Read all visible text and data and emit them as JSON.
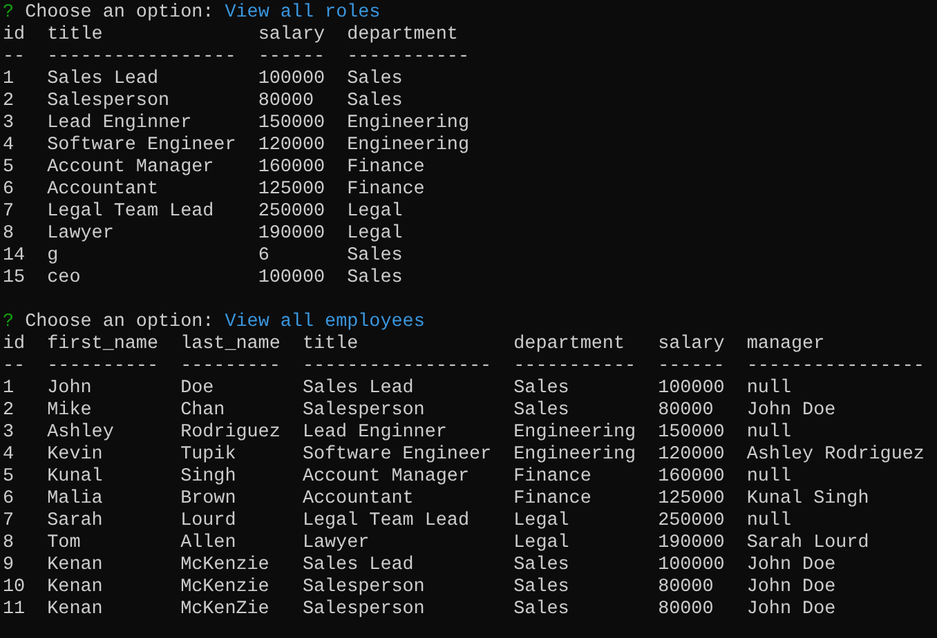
{
  "sections": [
    {
      "prompt": {
        "mark": "?",
        "label": "Choose an option:",
        "answer": "View all roles"
      },
      "columns": [
        "id",
        "title",
        "salary",
        "department"
      ],
      "dashes": [
        "--",
        "-----------------",
        "------",
        "-----------"
      ],
      "rows": [
        [
          "1",
          "Sales Lead",
          "100000",
          "Sales"
        ],
        [
          "2",
          "Salesperson",
          "80000",
          "Sales"
        ],
        [
          "3",
          "Lead Enginner",
          "150000",
          "Engineering"
        ],
        [
          "4",
          "Software Engineer",
          "120000",
          "Engineering"
        ],
        [
          "5",
          "Account Manager",
          "160000",
          "Finance"
        ],
        [
          "6",
          "Accountant",
          "125000",
          "Finance"
        ],
        [
          "7",
          "Legal Team Lead",
          "250000",
          "Legal"
        ],
        [
          "8",
          "Lawyer",
          "190000",
          "Legal"
        ],
        [
          "14",
          "g",
          "6",
          "Sales"
        ],
        [
          "15",
          "ceo",
          "100000",
          "Sales"
        ]
      ]
    },
    {
      "prompt": {
        "mark": "?",
        "label": "Choose an option:",
        "answer": "View all employees"
      },
      "columns": [
        "id",
        "first_name",
        "last_name",
        "title",
        "department",
        "salary",
        "manager"
      ],
      "dashes": [
        "--",
        "----------",
        "---------",
        "-----------------",
        "-----------",
        "------",
        "----------------"
      ],
      "rows": [
        [
          "1",
          "John",
          "Doe",
          "Sales Lead",
          "Sales",
          "100000",
          "null"
        ],
        [
          "2",
          "Mike",
          "Chan",
          "Salesperson",
          "Sales",
          "80000",
          "John Doe"
        ],
        [
          "3",
          "Ashley",
          "Rodriguez",
          "Lead Enginner",
          "Engineering",
          "150000",
          "null"
        ],
        [
          "4",
          "Kevin",
          "Tupik",
          "Software Engineer",
          "Engineering",
          "120000",
          "Ashley Rodriguez"
        ],
        [
          "5",
          "Kunal",
          "Singh",
          "Account Manager",
          "Finance",
          "160000",
          "null"
        ],
        [
          "6",
          "Malia",
          "Brown",
          "Accountant",
          "Finance",
          "125000",
          "Kunal Singh"
        ],
        [
          "7",
          "Sarah",
          "Lourd",
          "Legal Team Lead",
          "Legal",
          "250000",
          "null"
        ],
        [
          "8",
          "Tom",
          "Allen",
          "Lawyer",
          "Legal",
          "190000",
          "Sarah Lourd"
        ],
        [
          "9",
          "Kenan",
          "McKenzie",
          "Sales Lead",
          "Sales",
          "100000",
          "John Doe"
        ],
        [
          "10",
          "Kenan",
          "McKenzie",
          "Salesperson",
          "Sales",
          "80000",
          "John Doe"
        ],
        [
          "11",
          "Kenan",
          "McKenZie",
          "Salesperson",
          "Sales",
          "80000",
          "John Doe"
        ]
      ]
    }
  ]
}
